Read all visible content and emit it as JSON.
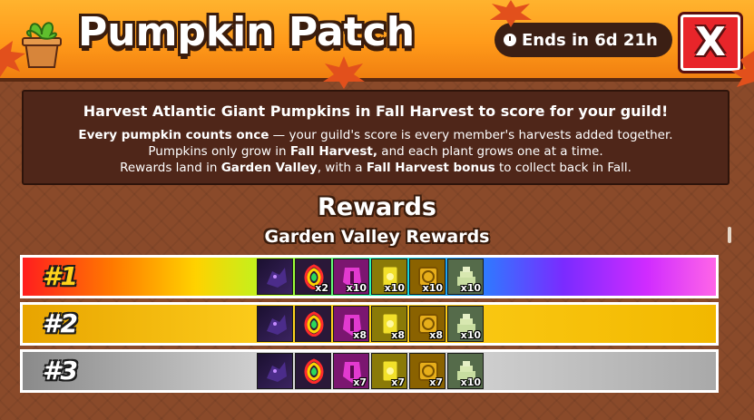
{
  "header": {
    "title": "Pumpkin Patch",
    "timer": "Ends in 6d 21h",
    "close_label": "X",
    "accent": "#ff9a1a"
  },
  "info": {
    "heading": "Harvest Atlantic Giant Pumpkins in Fall Harvest to score for your guild!",
    "line1_bold": "Every pumpkin counts once",
    "line1_rest": " — your guild's score is every member's harvests added together.",
    "line2_a": "Pumpkins only grow in ",
    "line2_bold": "Fall Harvest,",
    "line2_b": " and each plant grows one at a time.",
    "line3_a": "Rewards land in ",
    "line3_bold1": "Garden Valley",
    "line3_b": ", with a ",
    "line3_bold2": "Fall Harvest bonus",
    "line3_c": " to collect back in Fall."
  },
  "rewards": {
    "title": "Rewards",
    "subtitle": "Garden Valley Rewards",
    "rows": [
      {
        "rank": "#1",
        "counts": [
          "",
          "x2",
          "x10",
          "x10",
          "x10",
          "x10"
        ]
      },
      {
        "rank": "#2",
        "counts": [
          "",
          "",
          "x8",
          "x8",
          "x8",
          "x10"
        ]
      },
      {
        "rank": "#3",
        "counts": [
          "",
          "",
          "x7",
          "x7",
          "x7",
          "x10"
        ]
      }
    ],
    "item_icons": [
      "shadow-creature-icon",
      "rainbow-pet-icon",
      "pink-helmet-icon",
      "gold-card-icon",
      "gold-crate-icon",
      "green-cake-icon"
    ]
  }
}
